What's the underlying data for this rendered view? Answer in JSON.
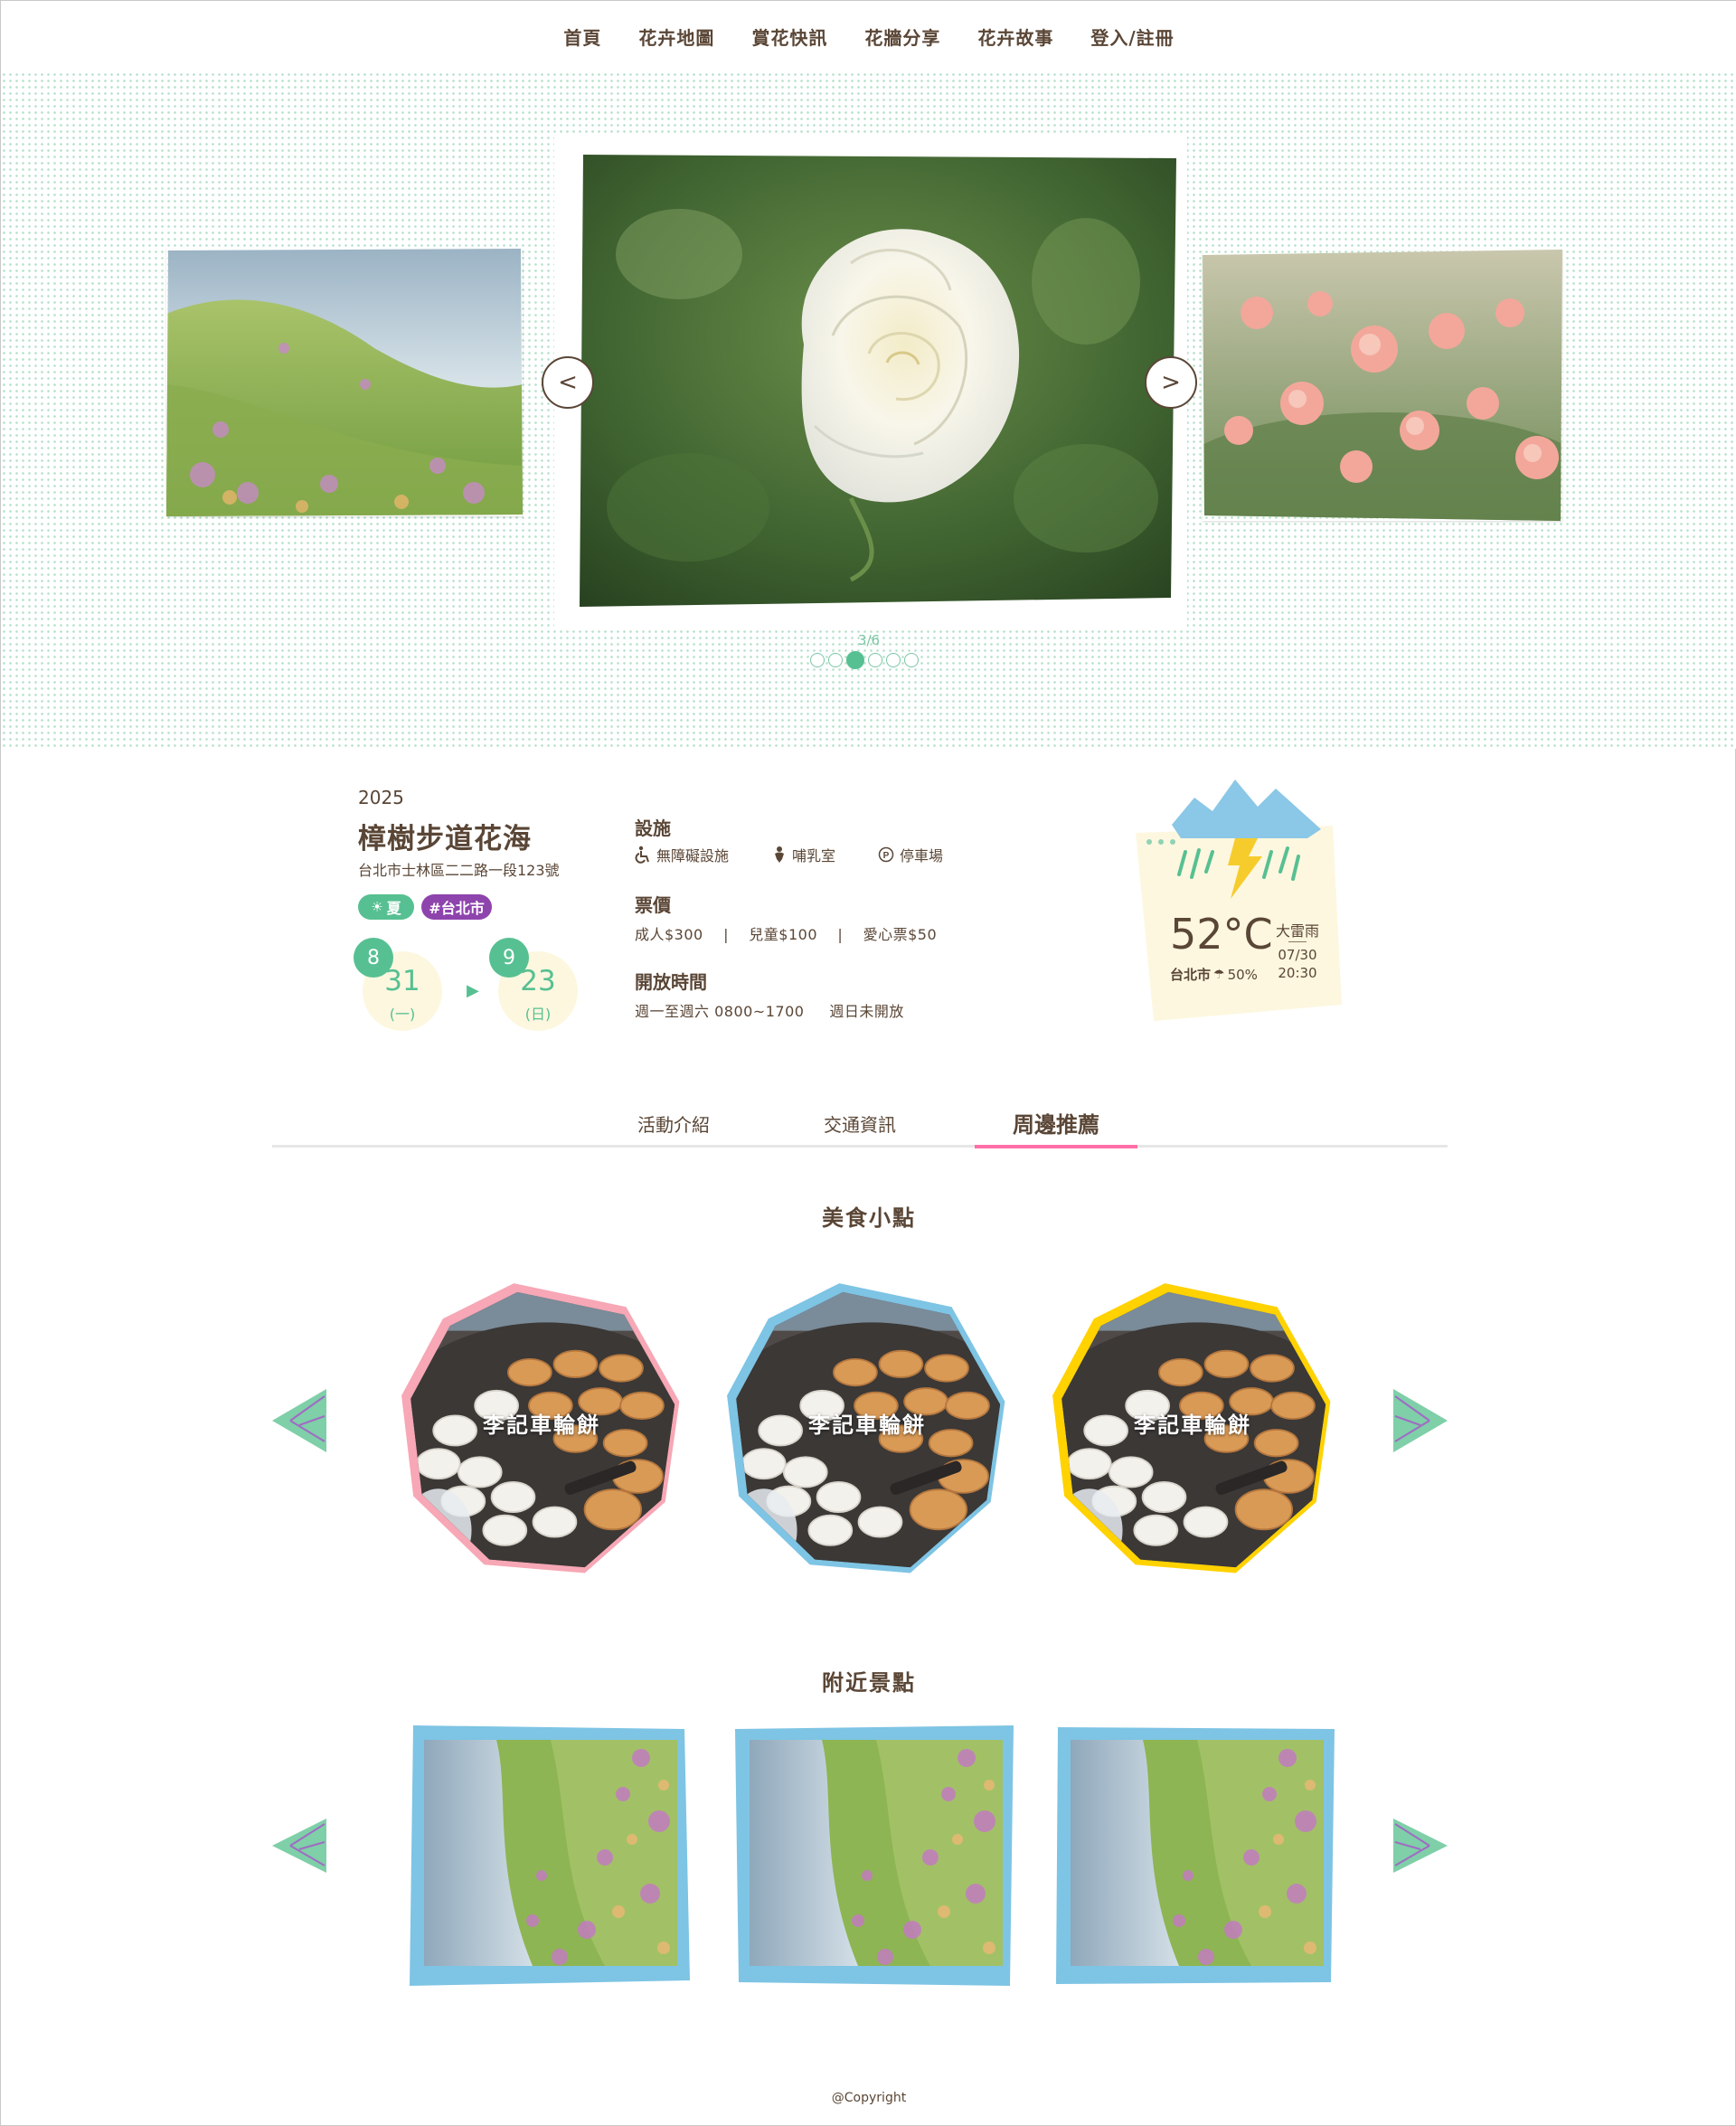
{
  "nav": {
    "items": [
      "首頁",
      "花卉地圖",
      "賞花快訊",
      "花牆分享",
      "花卉故事",
      "登入/註冊"
    ]
  },
  "carousel": {
    "prev_label": "<",
    "next_label": ">",
    "counter": "3/6",
    "current": 3,
    "total": 6
  },
  "event": {
    "year": "2025",
    "title": "樟樹步道花海",
    "address": "台北市士林區二二路一段123號",
    "tags": [
      {
        "label": "夏",
        "color": "#57c092",
        "icon": "sun-icon"
      },
      {
        "label": "#台北市",
        "color": "#8e44ad"
      }
    ],
    "start": {
      "month": "8",
      "day": "31",
      "weekday": "(一)"
    },
    "end": {
      "month": "9",
      "day": "23",
      "weekday": "(日)"
    },
    "arrow": "▶"
  },
  "facilities": {
    "heading": "設施",
    "items": [
      {
        "label": "無障礙設施",
        "icon": "wheelchair-icon"
      },
      {
        "label": "哺乳室",
        "icon": "baby-icon"
      },
      {
        "label": "停車場",
        "icon": "parking-icon"
      }
    ]
  },
  "tickets": {
    "heading": "票價",
    "line": "成人$300    |    兒童$100    |    愛心票$50"
  },
  "hours": {
    "heading": "開放時間",
    "line": "週一至週六 0800~1700     週日未開放"
  },
  "weather": {
    "temperature": "52°C",
    "location": "台北市",
    "rain_chance": "50%",
    "description": "大雷雨",
    "date": "07/30",
    "time": "20:30",
    "icon": "thunderstorm-icon"
  },
  "tabs": {
    "items": [
      "活動介紹",
      "交通資訊",
      "周邊推薦"
    ],
    "active": "周邊推薦"
  },
  "food": {
    "title": "美食小點",
    "cards": [
      {
        "name": "李記車輪餅",
        "frame_color": "#f7a7b5"
      },
      {
        "name": "李記車輪餅",
        "frame_color": "#7ec4e4"
      },
      {
        "name": "李記車輪餅",
        "frame_color": "#ffd200"
      }
    ]
  },
  "attractions": {
    "title": "附近景點",
    "cards": [
      {
        "frame_color": "#7ec4e4"
      },
      {
        "frame_color": "#7ec4e4"
      },
      {
        "frame_color": "#7ec4e4"
      }
    ]
  },
  "footer": {
    "copyright": "@Copyright"
  }
}
